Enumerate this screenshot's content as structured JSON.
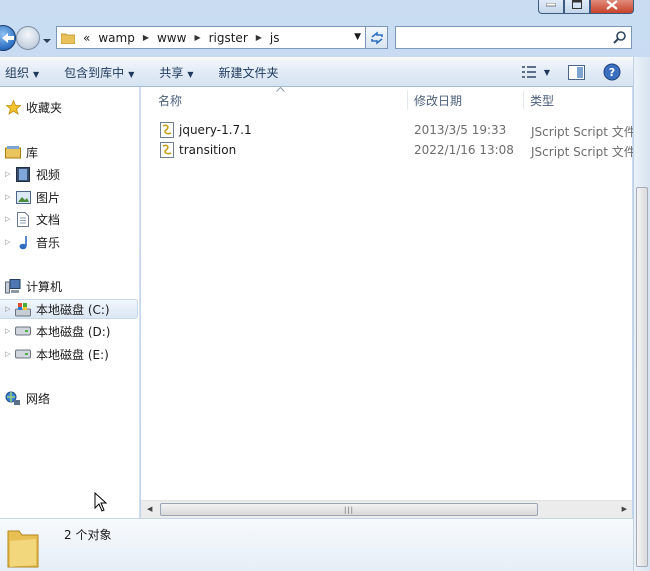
{
  "address_bar": {
    "overflow_marker": "«",
    "crumbs": [
      "wamp",
      "www",
      "rigster",
      "js"
    ]
  },
  "toolbar": {
    "organize": "组织",
    "include_in_library": "包含到库中",
    "share": "共享",
    "new_folder": "新建文件夹"
  },
  "nav": {
    "favorites": "收藏夹",
    "libraries": "库",
    "videos": "视频",
    "pictures": "图片",
    "documents": "文档",
    "music": "音乐",
    "computer": "计算机",
    "drive_c": "本地磁盘 (C:)",
    "drive_d": "本地磁盘 (D:)",
    "drive_e": "本地磁盘 (E:)",
    "network": "网络"
  },
  "columns": {
    "name": "名称",
    "modified": "修改日期",
    "type": "类型"
  },
  "files": [
    {
      "name": "jquery-1.7.1",
      "modified": "2013/3/5 19:33",
      "type": "JScript Script 文件"
    },
    {
      "name": "transition",
      "modified": "2022/1/16 13:08",
      "type": "JScript Script 文件"
    }
  ],
  "status": {
    "item_count": "2 个对象"
  },
  "colors": {
    "accent": "#1e395b",
    "window_frame": "#c9dcf2",
    "toolbar_bg": "#e2ebf6",
    "selected_row": "#dbe7f4"
  }
}
